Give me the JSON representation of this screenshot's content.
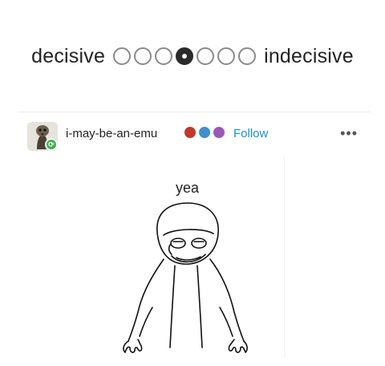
{
  "scale": {
    "left_label": "decisive",
    "right_label": "indecisive",
    "option_count": 7,
    "selected_index": 3
  },
  "post": {
    "username": "i-may-be-an-emu",
    "follow_label": "Follow",
    "more_icon": "ellipsis-icon",
    "badge_colors": [
      "#c0392b",
      "#3f8fc8",
      "#9b59b6"
    ],
    "avatar_icon": "emu-avatar",
    "reblog_icon": "reblog-icon",
    "reblog_color": "#3db14b"
  },
  "drawing": {
    "caption": "yea"
  }
}
